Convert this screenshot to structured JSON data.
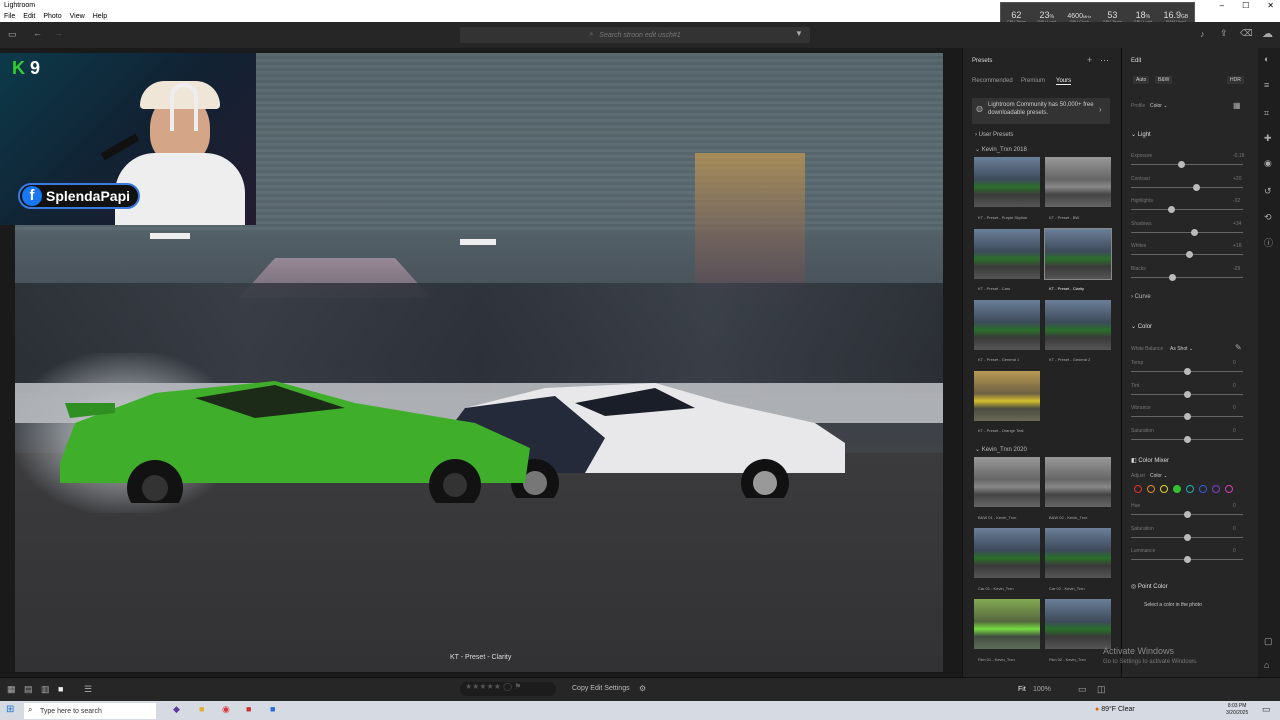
{
  "window": {
    "title": "Lightroom"
  },
  "menu": [
    "File",
    "Edit",
    "Photo",
    "View",
    "Help"
  ],
  "perf": [
    {
      "value": "62",
      "label": "CPU Temp"
    },
    {
      "value": "23",
      "unit": "%",
      "label": "GPU Load"
    },
    {
      "value": "4600",
      "unit": "MHz",
      "label": "GPU Clock"
    },
    {
      "value": "53",
      "label": "GPU Temp"
    },
    {
      "value": "18",
      "unit": "%",
      "label": "GPU Load"
    },
    {
      "value": "16.9",
      "unit": "GB",
      "label": "RAM Used"
    }
  ],
  "search": {
    "placeholder": "Search stroon edit usch#1"
  },
  "webcam": {
    "k": "K",
    "num": "9",
    "fb_name": "SplendaPapi"
  },
  "photo": {
    "caption": "KT - Preset - Clarity"
  },
  "presets": {
    "title": "Presets",
    "tabs": [
      "Recommended",
      "Premium",
      "Yours"
    ],
    "promo": "Lightroom Community has 50,000+ free downloadable presets.",
    "user_presets": "User Presets",
    "group1": "Kevin_Trxn 2018",
    "group2": "Kevin_Trxn 2020",
    "items1": [
      "KT - Preset - Purple Skyline",
      "KT - Preset - BW",
      "KT - Preset - Cars",
      "KT - Preset - Clarity",
      "KT - Preset - General 1",
      "KT - Preset - General 2",
      "KT - Preset - Orange Teal"
    ],
    "items2": [
      "B&W 01 - Kevin_Trxn",
      "B&W 02 - Kevin_Trxn",
      "Car 01 - Kevin_Trxn",
      "Car 02 - Kevin_Trxn",
      "Film 01 - Kevin_Trxn",
      "Film 02 - Kevin_Trxn"
    ]
  },
  "edit": {
    "title": "Edit",
    "auto": "Auto",
    "bw": "B&W",
    "hdr": "HDR",
    "profile_label": "Profile",
    "profile_value": "Color",
    "light": "Light",
    "light_sliders": [
      {
        "name": "Exposure",
        "value": "-0.18",
        "pos": 0.45
      },
      {
        "name": "Contrast",
        "value": "+20",
        "pos": 0.58
      },
      {
        "name": "Highlights",
        "value": "-32",
        "pos": 0.36
      },
      {
        "name": "Shadows",
        "value": "+34",
        "pos": 0.56
      },
      {
        "name": "Whites",
        "value": "+18",
        "pos": 0.52
      },
      {
        "name": "Blacks",
        "value": "-29",
        "pos": 0.37
      }
    ],
    "curve": "Curve",
    "color": "Color",
    "wb_label": "White Balance",
    "wb_value": "As Shot",
    "color_sliders": [
      {
        "name": "Temp",
        "value": "0",
        "pos": 0.5
      },
      {
        "name": "Tint",
        "value": "0",
        "pos": 0.5
      },
      {
        "name": "Vibrance",
        "value": "0",
        "pos": 0.5
      },
      {
        "name": "Saturation",
        "value": "0",
        "pos": 0.5
      }
    ],
    "mixer": "Color Mixer",
    "adjust_label": "Adjust",
    "adjust_value": "Color",
    "mixer_sliders": [
      {
        "name": "Hue",
        "value": "0",
        "pos": 0.5
      },
      {
        "name": "Saturation",
        "value": "0",
        "pos": 0.5
      },
      {
        "name": "Luminance",
        "value": "0",
        "pos": 0.5
      }
    ],
    "mixer_colors": [
      "#e03030",
      "#e08a20",
      "#e0d020",
      "#30c030",
      "#20b0b0",
      "#3060e0",
      "#8040d0",
      "#d040b0"
    ],
    "point": "Point Color",
    "point_hint": "Select a color in the photo",
    "watermark1": "Activate Windows",
    "watermark2": "Go to Settings to activate Windows."
  },
  "bottom": {
    "copy": "Copy Edit Settings",
    "fit": "Fit",
    "zoom": "100%"
  },
  "taskbar": {
    "search": "Type here to search",
    "weather": "89°F  Clear",
    "time": "8:03 PM",
    "date": "3/20/2025"
  }
}
